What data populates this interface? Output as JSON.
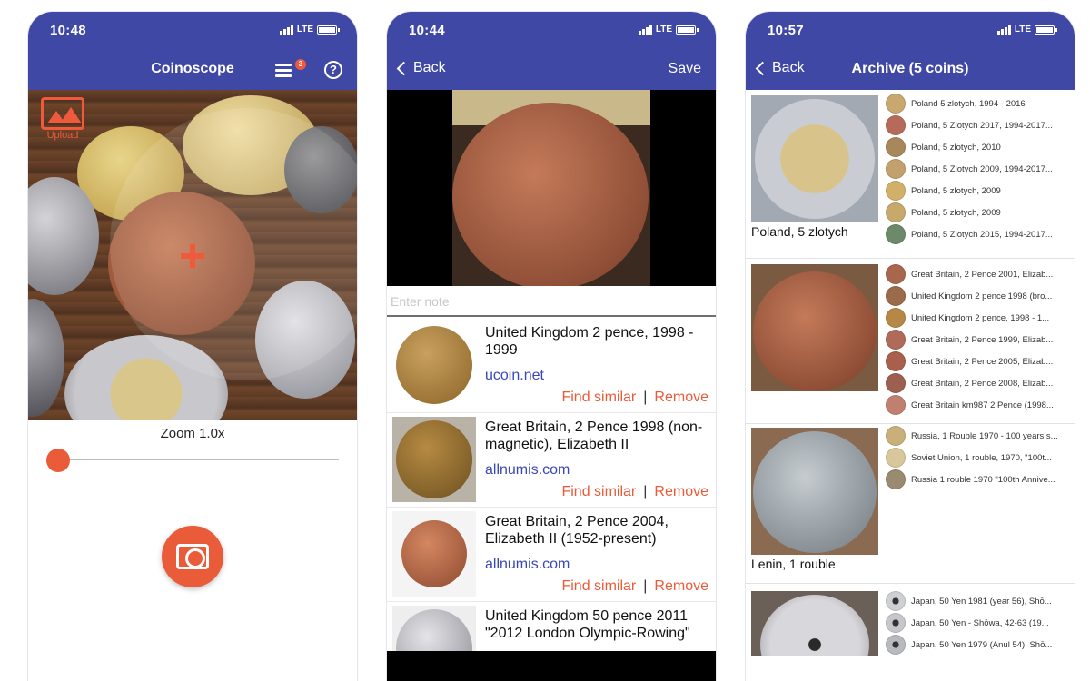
{
  "colors": {
    "primary": "#3f48a4",
    "accent": "#ea5b3a",
    "link": "#3a48b5"
  },
  "phone1": {
    "status_time": "10:48",
    "network": "LTE",
    "title": "Coinoscope",
    "history_badge": "3",
    "upload_label": "Upload",
    "zoom_label": "Zoom 1.0x",
    "zoom_level": 1.0
  },
  "phone2": {
    "status_time": "10:44",
    "network": "LTE",
    "back_label": "Back",
    "save_label": "Save",
    "note_placeholder": "Enter note",
    "results": [
      {
        "title": "United Kingdom 2 pence, 1998 - 1999",
        "source": "ucoin.net",
        "find_similar": "Find similar",
        "separator": "|",
        "remove": "Remove"
      },
      {
        "title": "Great Britain, 2 Pence 1998 (non-magnetic), Elizabeth II",
        "source": "allnumis.com",
        "find_similar": "Find similar",
        "separator": "|",
        "remove": "Remove"
      },
      {
        "title": "Great Britain, 2 Pence 2004, Elizabeth II (1952-present)",
        "source": "allnumis.com",
        "find_similar": "Find similar",
        "separator": "|",
        "remove": "Remove"
      },
      {
        "title": "United Kingdom 50 pence 2011 \"2012 London Olympic-Rowing\"",
        "source": "",
        "find_similar": "",
        "separator": "",
        "remove": ""
      }
    ]
  },
  "phone3": {
    "status_time": "10:57",
    "network": "LTE",
    "back_label": "Back",
    "title": "Archive (5 coins)",
    "groups": [
      {
        "label": "Poland, 5 zlotych",
        "matches": [
          "Poland 5 zlotych, 1994 - 2016",
          "Poland, 5 Zlotych 2017, 1994-2017...",
          "Poland, 5 zlotych, 2010",
          "Poland, 5 Zlotych 2009, 1994-2017...",
          "Poland, 5 zlotych, 2009",
          "Poland, 5 zlotych, 2009",
          "Poland, 5 Zlotych 2015, 1994-2017..."
        ]
      },
      {
        "label": "",
        "matches": [
          "Great Britain, 2 Pence 2001, Elizab...",
          "United Kingdom 2 pence 1998 (bro...",
          "United Kingdom 2 pence, 1998 - 1...",
          "Great Britain, 2 Pence 1999, Elizab...",
          "Great Britain, 2 Pence 2005, Elizab...",
          "Great Britain, 2 Pence 2008, Elizab...",
          "Great Britain km987 2 Pence (1998..."
        ]
      },
      {
        "label": "Lenin, 1 rouble",
        "matches": [
          "Russia, 1 Rouble 1970 - 100 years s...",
          "Soviet Union, 1 rouble, 1970, \"100t...",
          "Russia 1 rouble 1970 \"100th Annive..."
        ]
      },
      {
        "label": "",
        "matches": [
          "Japan, 50 Yen 1981 (year 56), Shō...",
          "Japan, 50 Yen - Shōwa, 42-63 (19...",
          "Japan, 50 Yen 1979 (Anul 54), Shō..."
        ]
      }
    ]
  }
}
